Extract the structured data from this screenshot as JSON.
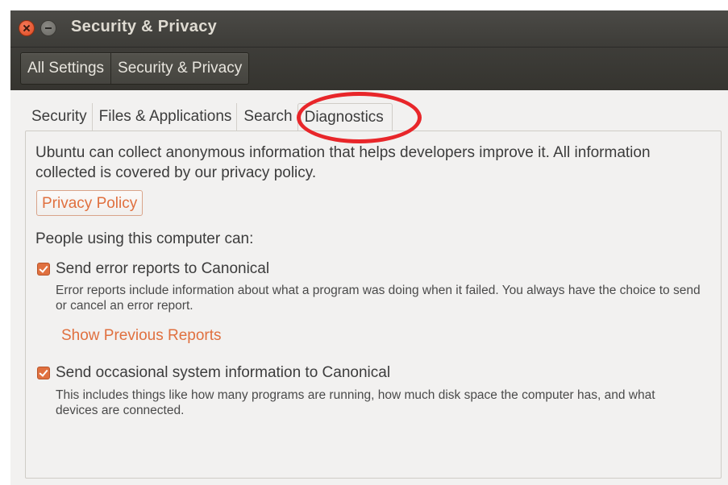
{
  "window": {
    "title": "Security & Privacy"
  },
  "breadcrumb": {
    "items": [
      "All Settings",
      "Security & Privacy"
    ]
  },
  "tabs": [
    {
      "label": "Security"
    },
    {
      "label": "Files & Applications"
    },
    {
      "label": "Search"
    },
    {
      "label": "Diagnostics",
      "active": true
    }
  ],
  "diagnostics": {
    "intro": "Ubuntu can collect anonymous information that helps developers improve it. All information collected is covered by our privacy policy.",
    "privacy_policy_button": "Privacy Policy",
    "people_label": "People using this computer can:",
    "error_reports": {
      "label": "Send error reports to Canonical",
      "checked": true,
      "description": "Error reports include information about what a program was doing when it failed. You always have the choice to send or cancel an error report."
    },
    "show_previous_reports": "Show Previous Reports",
    "system_info": {
      "label": "Send occasional system information to Canonical",
      "checked": true,
      "description": "This includes things like how many programs are running, how much disk space the computer has, and what devices are connected."
    }
  },
  "colors": {
    "accent": "#e0703f",
    "annotation": "#e8262a",
    "titlebar": "#3d3c38"
  }
}
